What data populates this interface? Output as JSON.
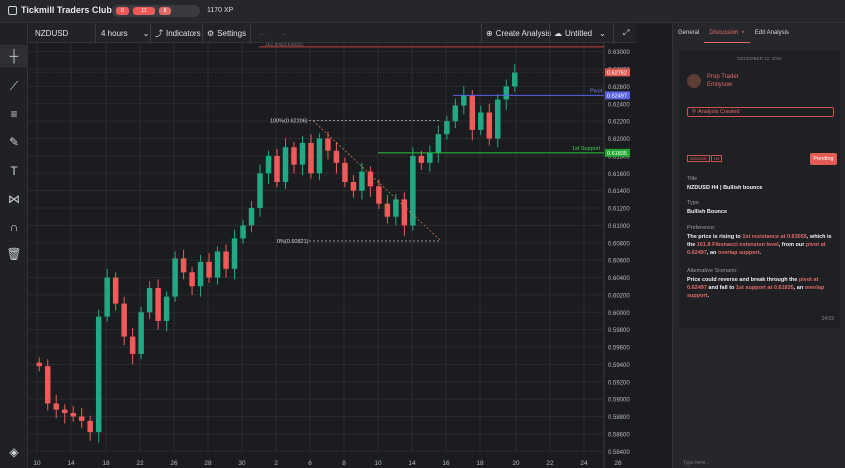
{
  "app": {
    "title": "Tickmill Traders Club",
    "progress": [
      "0",
      "11",
      "8"
    ],
    "xp": "1170 XP"
  },
  "toolbar": {
    "symbol": "NZDUSD",
    "interval": "4 hours",
    "indicators": "Indicators",
    "settings": "Settings",
    "create": "Create Analysis",
    "untitled": "Untitled"
  },
  "left_tools": [
    "crosshair-icon",
    "trendline-icon",
    "lines-icon",
    "brush-icon",
    "text-icon",
    "pattern-icon",
    "magnet-icon",
    "trash-icon"
  ],
  "panel": {
    "tabs": [
      "General",
      "Discussion",
      "Edit Analysis"
    ],
    "close_glyph": "×",
    "date": "DECEMBER 12, 2022",
    "author_role": "Prop Trader",
    "author_name": "Emilysow",
    "created": "Analysis Created",
    "tags": [
      "NZDUSD",
      "H4"
    ],
    "pending": "Pending",
    "title_label": "Title",
    "title": "NZDUSD H4 | Bullish bounce",
    "type_label": "Type",
    "type": "Bullish Bounce",
    "pref_label": "Preference:",
    "pref": {
      "a": "The price is rising to ",
      "b": "1st resistance at 0.63055",
      "c": ", which is the ",
      "d": "161.8 Fibonacci extension level",
      "e": ", from our ",
      "f": "pivot at 0.62497",
      "g": ", an ",
      "h": "overlap support",
      "i": "."
    },
    "alt_label": "Alternative Scenario:",
    "alt": {
      "a": "Price could reverse and break through the ",
      "b": "pivot at 0.62497",
      "c": " and fall to ",
      "d": "1st support at 0.61835",
      "e": ", an ",
      "f": "overlap support",
      "g": "."
    },
    "time": "14:02",
    "reply": "Type here..."
  },
  "colors": {
    "bull": "#22a884",
    "bear": "#f05a58",
    "pivot": "#5a62e6",
    "support": "#2ec23e",
    "accent": "#e06b66"
  },
  "chart_data": {
    "type": "candlestick",
    "symbol": "NZDUSD",
    "interval": "4 hours",
    "y_ticks": [
      "0.63000",
      "0.62800",
      "0.62600",
      "0.62400",
      "0.62200",
      "0.62000",
      "0.61800",
      "0.61600",
      "0.61400",
      "0.61200",
      "0.61000",
      "0.60800",
      "0.60600",
      "0.60400",
      "0.60200",
      "0.60000",
      "0.59800",
      "0.59600",
      "0.59400",
      "0.59200",
      "0.59000",
      "0.58800",
      "0.58600",
      "0.58400"
    ],
    "x_ticks": [
      "10",
      "14",
      "18",
      "22",
      "26",
      "28",
      "30",
      "2",
      "6",
      "8",
      "10",
      "14",
      "16",
      "18",
      "20",
      "22",
      "24",
      "26"
    ],
    "ylim": [
      0.5838,
      0.631
    ],
    "last_price": "0.62762",
    "pivot": {
      "label": "Pivot",
      "value": "0.62497"
    },
    "support": {
      "label": "1st Support",
      "value": "0.61835"
    },
    "fib": {
      "high": "100%(0.62206)",
      "low": "0%(0.60821)",
      "top": "161.8%(0.63055)"
    },
    "closes": [
      0.5938,
      0.5895,
      0.5888,
      0.5884,
      0.588,
      0.5875,
      0.5862,
      0.5995,
      0.604,
      0.601,
      0.5972,
      0.5952,
      0.6,
      0.6028,
      0.599,
      0.6018,
      0.6062,
      0.6046,
      0.603,
      0.6058,
      0.604,
      0.607,
      0.605,
      0.6085,
      0.61,
      0.612,
      0.616,
      0.618,
      0.615,
      0.619,
      0.617,
      0.6195,
      0.616,
      0.62,
      0.6186,
      0.6172,
      0.615,
      0.614,
      0.6162,
      0.6145,
      0.6125,
      0.611,
      0.613,
      0.61,
      0.618,
      0.6172,
      0.6184,
      0.6205,
      0.622,
      0.6238,
      0.625,
      0.621,
      0.623,
      0.62,
      0.6245,
      0.626,
      0.6276
    ]
  }
}
